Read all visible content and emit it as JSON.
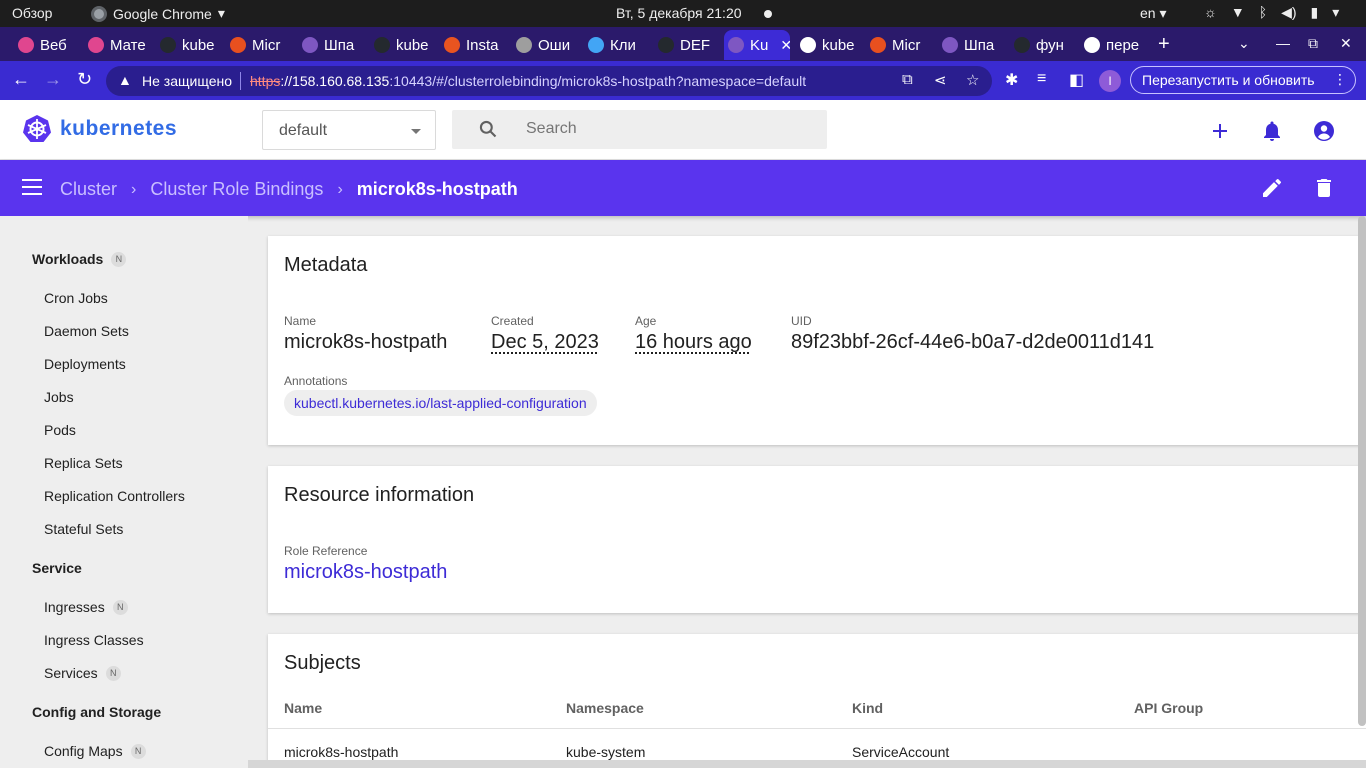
{
  "system_bar": {
    "activities": "Обзор",
    "app_name": "Google Chrome",
    "clock": "Вт, 5 декабря  21:20",
    "language": "en"
  },
  "tabs": [
    {
      "label": "Веб",
      "favicon": "multicolor-app-icon",
      "color": "#e0468f"
    },
    {
      "label": "Мате",
      "favicon": "multicolor-app-icon",
      "color": "#e0468f"
    },
    {
      "label": "kube",
      "favicon": "github-icon",
      "color": "#24292e"
    },
    {
      "label": "Micr",
      "favicon": "gmail-m-icon",
      "color": "#e8501f"
    },
    {
      "label": "Шпа",
      "favicon": "kubernetes-icon",
      "color": "#7e57c2"
    },
    {
      "label": "kube",
      "favicon": "github-icon",
      "color": "#24292e"
    },
    {
      "label": "Insta",
      "favicon": "ubuntu-icon",
      "color": "#e95420"
    },
    {
      "label": "Оши",
      "favicon": "kubernetes-icon",
      "color": "#9e9e9e"
    },
    {
      "label": "Кли",
      "favicon": "k8s-blue-icon",
      "color": "#42a5f5"
    },
    {
      "label": "DEF",
      "favicon": "github-icon",
      "color": "#24292e"
    },
    {
      "label": "Ku",
      "favicon": "kubernetes-icon",
      "color": "#7e57c2",
      "active": true
    },
    {
      "label": "kube",
      "favicon": "globe-icon",
      "color": "#ffffff"
    },
    {
      "label": "Micr",
      "favicon": "gmail-m-icon",
      "color": "#e8501f"
    },
    {
      "label": "Шпа",
      "favicon": "kubernetes-icon",
      "color": "#7e57c2"
    },
    {
      "label": "фун",
      "favicon": "github-icon",
      "color": "#24292e"
    },
    {
      "label": "пере",
      "favicon": "google-icon",
      "color": "#ffffff"
    }
  ],
  "address_bar": {
    "security_label": "Не защищено",
    "url_scheme": "https",
    "url_host": "://158.160.68.135",
    "url_rest": ":10443/#/clusterrolebinding/microk8s-hostpath?namespace=default",
    "profile_initial": "I",
    "relaunch_label": "Перезапустить и обновить"
  },
  "header": {
    "brand": "kubernetes",
    "namespace": "default",
    "search_placeholder": "Search"
  },
  "breadcrumb": {
    "items": [
      "Cluster",
      "Cluster Role Bindings"
    ],
    "current": "microk8s-hostpath"
  },
  "sidebar": {
    "sections": [
      {
        "title": "Workloads",
        "badge": "N",
        "items": [
          {
            "label": "Cron Jobs"
          },
          {
            "label": "Daemon Sets"
          },
          {
            "label": "Deployments"
          },
          {
            "label": "Jobs"
          },
          {
            "label": "Pods"
          },
          {
            "label": "Replica Sets"
          },
          {
            "label": "Replication Controllers"
          },
          {
            "label": "Stateful Sets"
          }
        ]
      },
      {
        "title": "Service",
        "items": [
          {
            "label": "Ingresses",
            "badge": "N"
          },
          {
            "label": "Ingress Classes"
          },
          {
            "label": "Services",
            "badge": "N"
          }
        ]
      },
      {
        "title": "Config and Storage",
        "items": [
          {
            "label": "Config Maps",
            "badge": "N"
          }
        ]
      }
    ]
  },
  "metadata": {
    "title": "Metadata",
    "name_label": "Name",
    "name": "microk8s-hostpath",
    "created_label": "Created",
    "created": "Dec 5, 2023",
    "age_label": "Age",
    "age": "16 hours ago",
    "uid_label": "UID",
    "uid": "89f23bbf-26cf-44e6-b0a7-d2de0011d141",
    "annotations_label": "Annotations",
    "annotation": "kubectl.kubernetes.io/last-applied-configuration"
  },
  "resource_info": {
    "title": "Resource information",
    "role_ref_label": "Role Reference",
    "role_ref": "microk8s-hostpath"
  },
  "subjects": {
    "title": "Subjects",
    "columns": [
      "Name",
      "Namespace",
      "Kind",
      "API Group"
    ],
    "rows": [
      [
        "microk8s-hostpath",
        "kube-system",
        "ServiceAccount",
        ""
      ]
    ]
  },
  "colors": {
    "primary": "#3d2bd6",
    "breadcrumb_bar": "#5a34ee",
    "k8s_blue": "#326ce5"
  }
}
